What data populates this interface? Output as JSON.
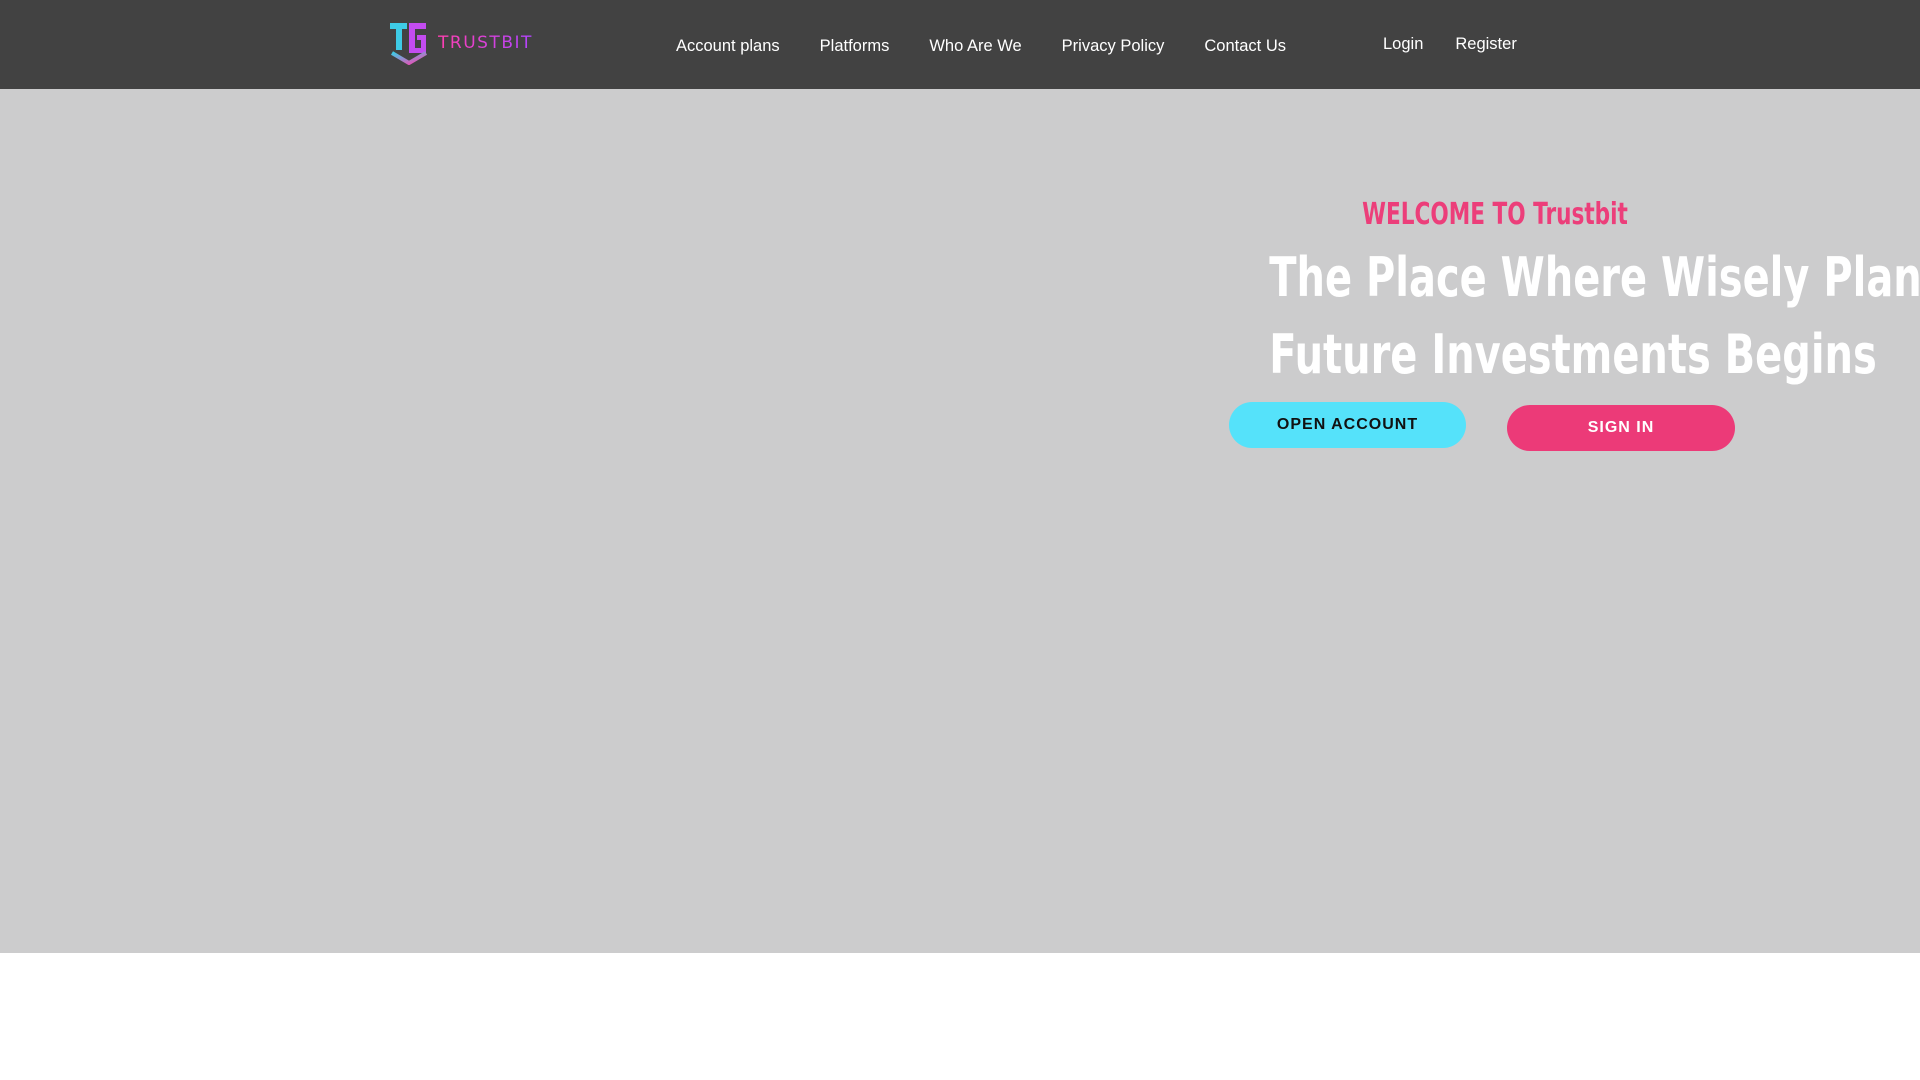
{
  "brand": {
    "name": "TRUSTBIT",
    "logo_icon": "tb-shield-logo-icon",
    "colors": {
      "pink": "#ff3fb0",
      "purple": "#b244ff",
      "cyan": "#3ecbe6"
    }
  },
  "nav": {
    "items": [
      {
        "label": "Account plans"
      },
      {
        "label": "Platforms"
      },
      {
        "label": "Who Are We"
      },
      {
        "label": "Privacy Policy"
      },
      {
        "label": "Contact Us"
      }
    ]
  },
  "auth": {
    "login_label": "Login",
    "register_label": "Register"
  },
  "hero": {
    "welcome": "WELCOME TO Trustbit",
    "headline_line1": "The Place Where Wisely Planed",
    "headline_line2": "Future Investments Begins",
    "open_account_label": "OPEN ACCOUNT",
    "sign_in_label": "SIGN IN"
  },
  "colors": {
    "header_bg": "#424242",
    "hero_bg": "#cccccd",
    "welcome_text": "#ec3e7a",
    "open_account_bg": "#55e2fa",
    "sign_in_bg": "#ec3a78"
  }
}
